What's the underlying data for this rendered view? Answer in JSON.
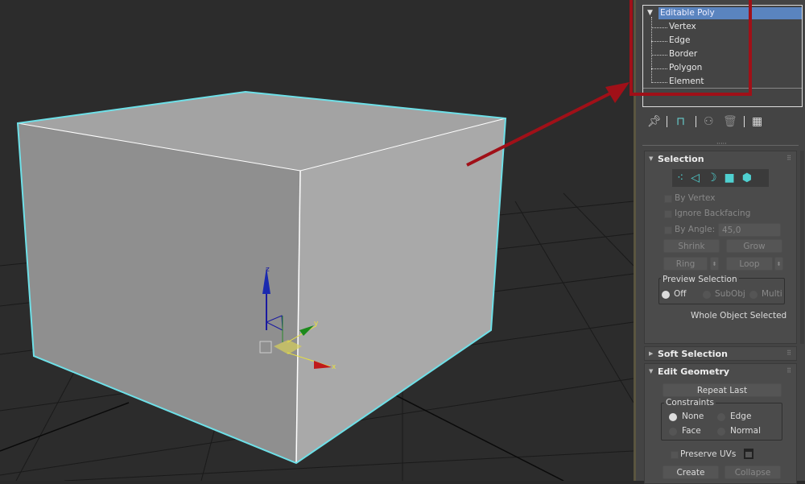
{
  "modifier_stack": {
    "root": "Editable Poly",
    "subobjects": [
      "Vertex",
      "Edge",
      "Border",
      "Polygon",
      "Element"
    ]
  },
  "toolbar_icons": [
    "pin-stack-icon",
    "show-end-result-icon",
    "make-unique-icon",
    "remove-modifier-icon",
    "configure-modifier-sets-icon"
  ],
  "selection": {
    "title": "Selection",
    "level_icons": [
      "vertex-icon",
      "edge-icon",
      "border-icon",
      "polygon-icon",
      "element-icon"
    ],
    "by_vertex": "By Vertex",
    "ignore_backfacing": "Ignore Backfacing",
    "by_angle": "By Angle:",
    "angle_value": "45,0",
    "shrink": "Shrink",
    "grow": "Grow",
    "ring": "Ring",
    "loop": "Loop",
    "preview_title": "Preview Selection",
    "preview_off": "Off",
    "preview_subobj": "SubObj",
    "preview_multi": "Multi",
    "status": "Whole Object Selected"
  },
  "soft_selection": {
    "title": "Soft Selection"
  },
  "edit_geometry": {
    "title": "Edit Geometry",
    "repeat_last": "Repeat Last",
    "constraints_title": "Constraints",
    "none": "None",
    "edge": "Edge",
    "face": "Face",
    "normal": "Normal",
    "preserve_uvs": "Preserve UVs",
    "create": "Create",
    "collapse": "Collapse"
  },
  "gizmo": {
    "x": "x",
    "y": "y",
    "z": "z"
  },
  "colors": {
    "accent_cyan": "#4fd0d0",
    "highlight": "#a01018",
    "selection_blue": "#5a84bf"
  }
}
